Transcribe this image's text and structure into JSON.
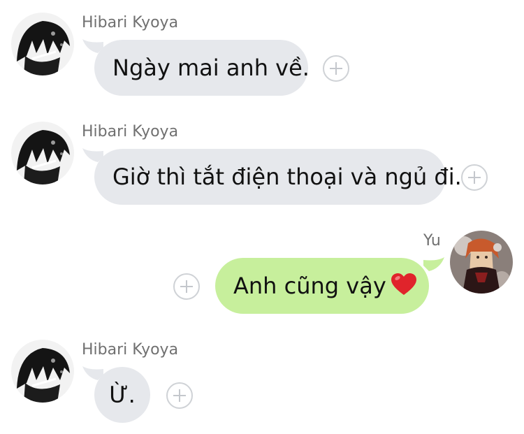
{
  "messages": [
    {
      "sender": "Hibari Kyoya",
      "text": "Ngày mai anh về.",
      "direction": "incoming"
    },
    {
      "sender": "Hibari Kyoya",
      "text": "Giờ thì tắt điện thoại và ngủ đi.",
      "direction": "incoming"
    },
    {
      "sender": "Yu",
      "text": "Anh cũng vậy",
      "emoji": "red-heart",
      "direction": "outgoing"
    },
    {
      "sender": "Hibari Kyoya",
      "text": "Ừ.",
      "direction": "incoming"
    }
  ],
  "colors": {
    "incoming_bubble": "#e6e8ec",
    "outgoing_bubble": "#c7ef9c",
    "sender_name": "#707070",
    "heart": "#e0242b"
  },
  "icons": {
    "reaction_button": "plus-circle-icon",
    "emoji": "red-heart-icon"
  }
}
